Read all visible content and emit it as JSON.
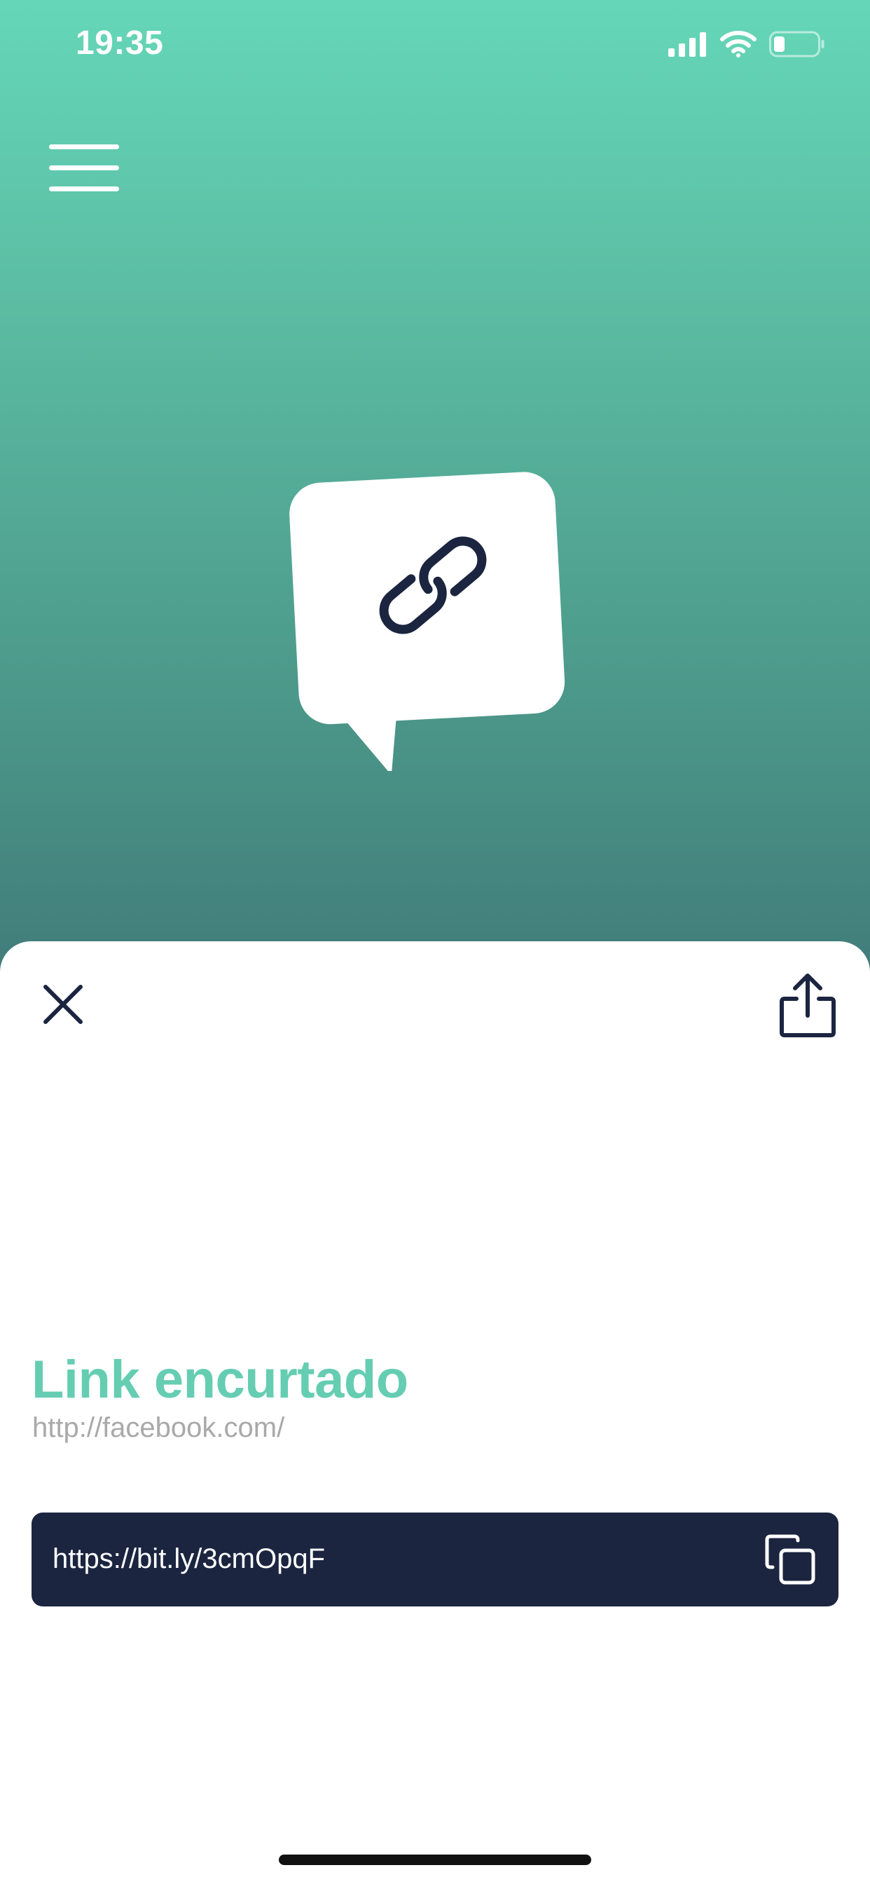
{
  "status_bar": {
    "time": "19:35",
    "icons": [
      "cellular-signal-icon",
      "wifi-icon",
      "battery-icon"
    ]
  },
  "header": {
    "menu_icon": "hamburger-menu-icon"
  },
  "hero": {
    "icon": "link-chat-bubble-icon"
  },
  "sheet": {
    "close_icon": "close-icon",
    "share_icon": "share-icon",
    "title": "Link encurtado",
    "original_url": "http://facebook.com/",
    "short_url": "https://bit.ly/3cmOpqF",
    "copy_icon": "copy-icon"
  },
  "colors": {
    "gradient_top": "#65d7b8",
    "gradient_bottom": "#417c7a",
    "accent": "#65cdb2",
    "dark_navy": "#1b2540",
    "muted_text": "#a9a9a9"
  }
}
